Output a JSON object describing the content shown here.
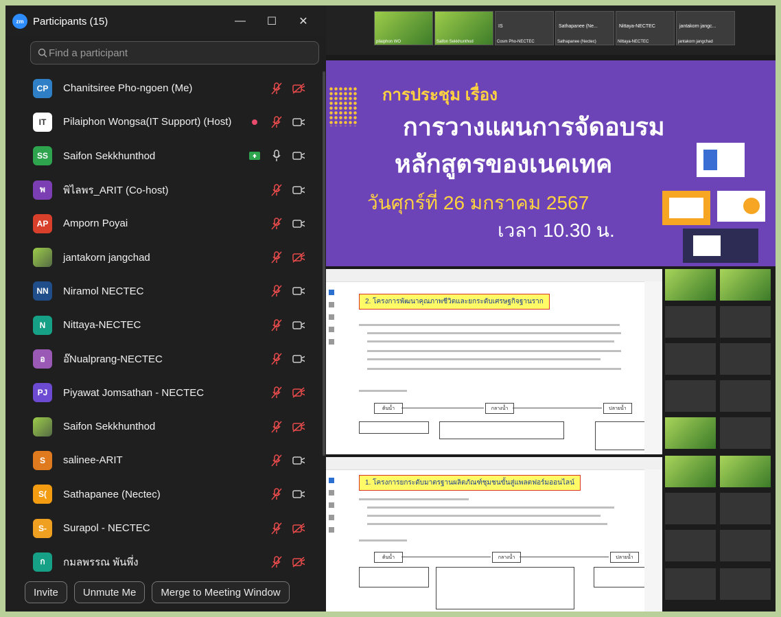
{
  "panel": {
    "title": "Participants (15)",
    "logo_text": "zm",
    "search_placeholder": "Find a participant",
    "participants": [
      {
        "name": "Chanitsiree Pho-ngoen (Me)",
        "initials": "CP",
        "color": "#2f7fc6",
        "mic": "muted",
        "video": "off"
      },
      {
        "name": "Pilaiphon Wongsa(IT Support) (Host)",
        "initials": "IT",
        "color": "#ffffff",
        "mic": "muted",
        "video": "on",
        "recording": true
      },
      {
        "name": "Saifon Sekkhunthod",
        "initials": "SS",
        "color": "#2ea44f",
        "mic": "on",
        "video": "on",
        "share": true
      },
      {
        "name": "พิไลพร_ARIT (Co-host)",
        "initials": "พ",
        "color": "#7b3fb3",
        "mic": "muted",
        "video": "on"
      },
      {
        "name": "Amporn Poyai",
        "initials": "AP",
        "color": "#d9402b",
        "mic": "muted",
        "video": "on"
      },
      {
        "name": "jantakorn jangchad",
        "initials": "",
        "color": "#5a7a5a",
        "mic": "muted",
        "video": "off",
        "photo": true
      },
      {
        "name": "Niramol NECTEC",
        "initials": "NN",
        "color": "#1f4e8a",
        "mic": "muted",
        "video": "on"
      },
      {
        "name": "Nittaya-NECTEC",
        "initials": "N",
        "color": "#16a085",
        "mic": "muted",
        "video": "on"
      },
      {
        "name": "อ๊Nualprang-NECTEC",
        "initials": "อ",
        "color": "#9b59b6",
        "mic": "muted",
        "video": "on"
      },
      {
        "name": "Piyawat Jomsathan - NECTEC",
        "initials": "PJ",
        "color": "#6c4ad1",
        "mic": "muted",
        "video": "off"
      },
      {
        "name": "Saifon Sekkhunthod",
        "initials": "",
        "color": "#7ab648",
        "mic": "muted",
        "video": "off",
        "photo": true
      },
      {
        "name": "salinee-ARIT",
        "initials": "S",
        "color": "#e07a1f",
        "mic": "muted",
        "video": "on"
      },
      {
        "name": "Sathapanee (Nectec)",
        "initials": "S(",
        "color": "#f39c12",
        "mic": "muted",
        "video": "on"
      },
      {
        "name": "Surapol - NECTEC",
        "initials": "S-",
        "color": "#f0a020",
        "mic": "muted",
        "video": "off"
      },
      {
        "name": "กมลพรรณ พันพึ่ง",
        "initials": "ก",
        "color": "#16a085",
        "mic": "muted",
        "video": "off"
      }
    ],
    "buttons": {
      "invite": "Invite",
      "unmute": "Unmute Me",
      "merge": "Merge to Meeting Window"
    }
  },
  "meeting": {
    "strip": [
      {
        "name": "",
        "label": "pilaiphon WO",
        "green": true
      },
      {
        "name": "",
        "label": "Saifon Sekkhunthod",
        "green": true
      },
      {
        "name": "IS",
        "label": "Cosm Pho-NECTEC",
        "green": false
      },
      {
        "name": "Sathapanee (Ne...",
        "label": "Sathapanee (Nectec)",
        "green": false
      },
      {
        "name": "Nittaya-NECTEC",
        "label": "Nittaya-NECTEC",
        "green": false
      },
      {
        "name": "jantakorn jangc...",
        "label": "jantakorn jangchad",
        "green": false
      }
    ],
    "banner": {
      "subtitle": "การประชุม เรื่อง",
      "line1": "การวางแผนการจัดอบรม",
      "line2": "หลักสูตรของเนคเทค",
      "date": "วันศุกร์ที่ 26 มกราคม 2567",
      "time": "เวลา 10.30 น."
    },
    "doc1": {
      "heading": "2. โครงการพัฒนาคุณภาพชีวิตและยกระดับเศรษฐกิจฐานราก",
      "boxes": [
        "ต้นน้ำ",
        "กลางน้ำ",
        "ปลายน้ำ"
      ]
    },
    "doc2": {
      "heading": "1. โครงการยกระดับมาตรฐานผลิตภัณฑ์ชุมชนขั้นสู่แพลตฟอร์มออนไลน์",
      "boxes": [
        "ต้นน้ำ",
        "กลางน้ำ",
        "ปลายน้ำ"
      ]
    }
  }
}
